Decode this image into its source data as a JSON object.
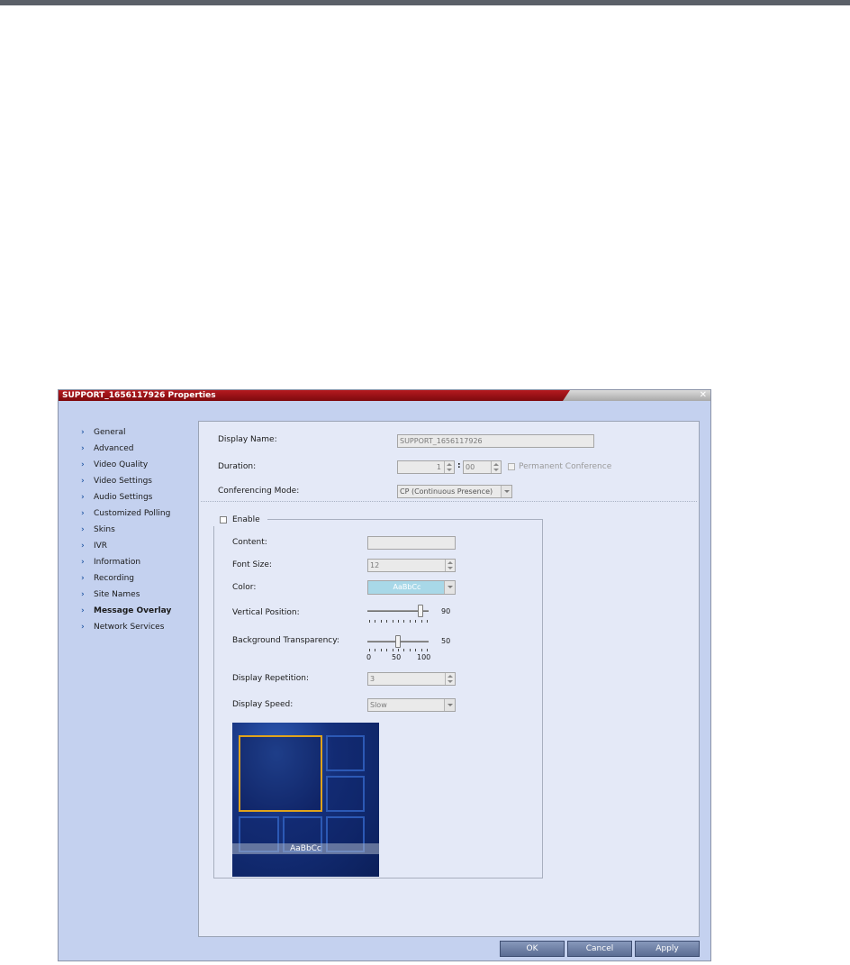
{
  "window": {
    "title": "SUPPORT_1656117926 Properties",
    "close_glyph": "✕"
  },
  "nav": {
    "items": [
      {
        "label": "General"
      },
      {
        "label": "Advanced"
      },
      {
        "label": "Video Quality"
      },
      {
        "label": "Video Settings"
      },
      {
        "label": "Audio Settings"
      },
      {
        "label": "Customized Polling"
      },
      {
        "label": "Skins"
      },
      {
        "label": "IVR"
      },
      {
        "label": "Information"
      },
      {
        "label": "Recording"
      },
      {
        "label": "Site Names"
      },
      {
        "label": "Message Overlay",
        "active": true
      },
      {
        "label": "Network Services"
      }
    ],
    "arrow_glyph": "›"
  },
  "form": {
    "display_name_label": "Display Name:",
    "display_name_value": "SUPPORT_1656117926",
    "duration_label": "Duration:",
    "duration_hours": "1",
    "duration_separator": ":",
    "duration_minutes": "00",
    "permanent_label": "Permanent Conference",
    "permanent_checked": false,
    "conf_mode_label": "Conferencing Mode:",
    "conf_mode_value": "CP (Continuous Presence)"
  },
  "overlay": {
    "enable_label": "Enable",
    "enable_checked": false,
    "content_label": "Content:",
    "content_value": "",
    "font_size_label": "Font Size:",
    "font_size_value": "12",
    "color_label": "Color:",
    "color_value": "AaBbCc",
    "color_swatch": "#a8d8e8",
    "vertical_position_label": "Vertical Position:",
    "vertical_position_value": "90",
    "vertical_position_fraction": 0.9,
    "bg_transparency_label": "Background Transparency:",
    "bg_transparency_value": "50",
    "bg_transparency_fraction": 0.5,
    "bg_transparency_ticks": [
      "0",
      "50",
      "100"
    ],
    "display_repetition_label": "Display Repetition:",
    "display_repetition_value": "3",
    "display_speed_label": "Display Speed:",
    "display_speed_value": "Slow",
    "preview_caption": "AaBbCc",
    "preview_frame_color": "#e0a31b"
  },
  "buttons": {
    "ok": "OK",
    "cancel": "Cancel",
    "apply": "Apply"
  },
  "colors": {
    "title_bar": "#9c1015",
    "dialog_bg": "#c4d1ef",
    "panel_bg": "#e4e9f7",
    "button": "#6f80a6"
  }
}
